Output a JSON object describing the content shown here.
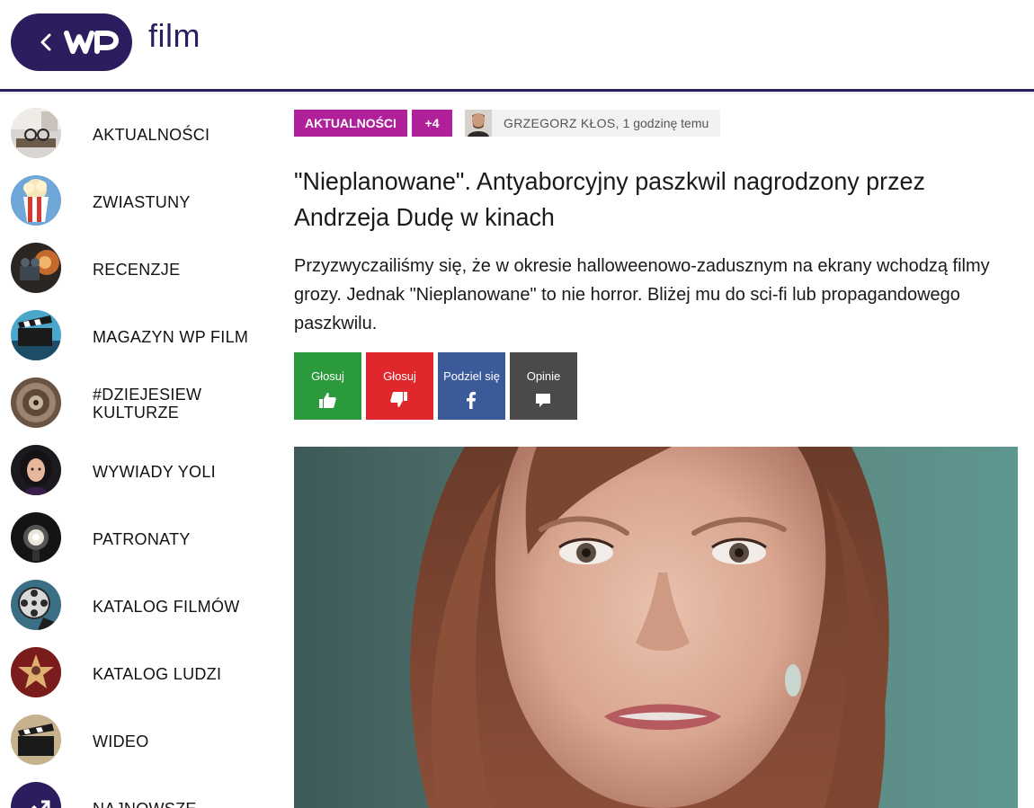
{
  "header": {
    "back_icon": "chevron-left-icon",
    "logo_text": "WP",
    "site_name": "film",
    "brand_color": "#2b1d5e"
  },
  "sidebar": {
    "items": [
      {
        "label": "AKTUALNOŚCI"
      },
      {
        "label": "ZWIASTUNY"
      },
      {
        "label": "RECENZJE"
      },
      {
        "label": "MAGAZYN WP FILM"
      },
      {
        "label_line1": "#DZIEJESIEW",
        "label_line2": "KULTURZE"
      },
      {
        "label": "WYWIADY YOLI"
      },
      {
        "label": "PATRONATY"
      },
      {
        "label": "KATALOG FILMÓW"
      },
      {
        "label": "KATALOG LUDZI"
      },
      {
        "label": "WIDEO"
      },
      {
        "label": "NAJNOWSZE"
      }
    ]
  },
  "article": {
    "category_tag": "AKTUALNOŚCI",
    "more_tags": "+4",
    "tag_color": "#b0209a",
    "author": "GRZEGORZ KŁOS,",
    "published": "1 godzinę temu",
    "title": "\"Nieplanowane\". Antyaborcyjny paszkwil nagrodzony przez Andrzeja Dudę w kinach",
    "lead": "Przyzwyczailiśmy się, że w okresie halloweenowo-zadusznym na ekrany wchodzą filmy grozy. Jednak \"Nieplanowane\" to nie horror. Bliżej mu do sci-fi lub propagandowego paszkwilu.",
    "actions": [
      {
        "label": "Głosuj",
        "icon": "thumbs-up-icon",
        "color": "#2a9a3c"
      },
      {
        "label": "Głosuj",
        "icon": "thumbs-down-icon",
        "color": "#e0282c"
      },
      {
        "label": "Podziel się",
        "icon": "facebook-icon",
        "color": "#3b5a9a"
      },
      {
        "label": "Opinie",
        "icon": "comment-icon",
        "color": "#4a4a4a"
      }
    ]
  }
}
